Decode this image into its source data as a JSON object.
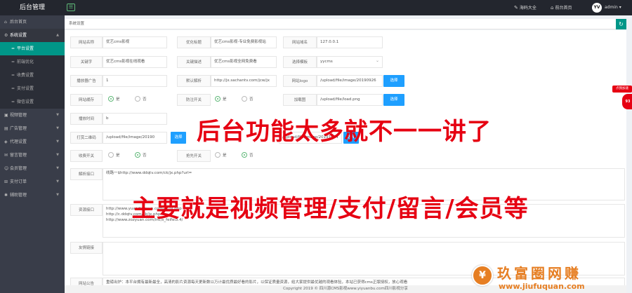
{
  "topbar": {
    "title": "后台管理",
    "menu_toggle_glyph": "☰",
    "links": [
      {
        "icon": "✎",
        "label": "海码大全"
      },
      {
        "icon": "⌂",
        "label": "前台首页"
      }
    ],
    "avatar_text": "YV",
    "user": "admin",
    "user_arrow": "▾"
  },
  "sidebar": {
    "home": "后台首页",
    "system": "系统设置",
    "system_subitems": [
      "平台设置",
      "前端优化",
      "收费设置",
      "支付设置",
      "微信设置"
    ],
    "items": [
      "视频管理",
      "广告管理",
      "代理设置",
      "留言管理",
      "会员管理",
      "支付订单",
      "辅助管理"
    ]
  },
  "tab": {
    "label": "系统设置",
    "refresh_glyph": "↻"
  },
  "form": {
    "site_name_label": "网站名称",
    "site_name_value": "优艺cms影视",
    "site_title_label": "优化标题",
    "site_title_value": "优艺cms影视-专业免费影视站",
    "site_domain_label": "网站域名",
    "site_domain_value": "127.0.0.1",
    "keywords_label": "关键字",
    "keywords_value": "优艺cms影视在线观看",
    "description_label": "关键描述",
    "description_value": "优艺cms影视全网免费看",
    "template_label": "选择模板",
    "template_value": "yycms",
    "ad_label": "播放器广告",
    "ad_value": "1",
    "default_parse_label": "默认解析",
    "default_parse_value": "http://jx.sachantv.com/jcw/jx",
    "logo_label": "网站logo",
    "logo_value": "/upload/file/image/20190926",
    "choose_label": "选择",
    "cache_label": "网站缓存",
    "yes_label": "是",
    "no_label": "否",
    "anti_injection_label": "防注开关",
    "loading_label": "加载图",
    "loading_value": "/upload/file/load.png",
    "play_time_label": "播放时间",
    "play_time_value": "b",
    "share_qr_label": "打赏二维码",
    "share_qr_value": "/upload/file/image/20190",
    "share_qr2_value": "/upload/file/image/20191014",
    "charge_switch_label": "收费开关",
    "invite_switch_label": "抢先开关",
    "parse_api_label": "解析接口",
    "parse_api_lines": [
      "线路一$http://www.ddqtv.com/ck/jx.php?url="
    ],
    "resource_label": "资源接口",
    "resource_lines": [
      "http://www.yuandianyun.com/ck/jx.php",
      "http://c.ddqtv.com/ck/jx.php",
      "http://www.zozyuan.com/inc/s_feifei3.4/"
    ],
    "friend_label": "友情链接",
    "notice_label": "网站公告",
    "notice_value": "重磅出炉：本平台拥有最新最全，高清的影片资源每天更新数以万计最优质最好看的影片，以保证质量资源，给大家提供最优越的观看体验，本站已获得cms正版授权，放心观看"
  },
  "footer": "Copyright 2019 © 四川源CMS影视www.yiyuanbu.com四川影视分享",
  "promo": {
    "line1": "后台功能太多就不一一讲了",
    "line2": "主要就是视频管理/支付/留言/会员等"
  },
  "float_widget": {
    "tag": "点我加速",
    "ball": "93"
  },
  "watermark": {
    "logo_glyph": "¥",
    "title": "玖富圈网赚",
    "url": "www.jiufuquan.com"
  }
}
